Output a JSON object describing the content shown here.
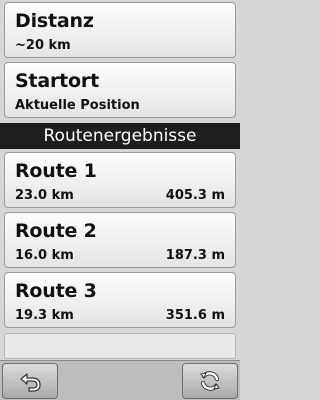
{
  "distance": {
    "title": "Distanz",
    "value": "~20 km"
  },
  "start": {
    "title": "Startort",
    "value": "Aktuelle Position"
  },
  "results_header": "Routenergebnisse",
  "routes": [
    {
      "title": "Route 1",
      "distance": "23.0 km",
      "elevation": "405.3 m"
    },
    {
      "title": "Route 2",
      "distance": "16.0 km",
      "elevation": "187.3 m"
    },
    {
      "title": "Route 3",
      "distance": "19.3 km",
      "elevation": "351.6 m"
    }
  ],
  "toolbar": {
    "back_icon": "back-arrow-icon",
    "refresh_icon": "refresh-icon"
  }
}
